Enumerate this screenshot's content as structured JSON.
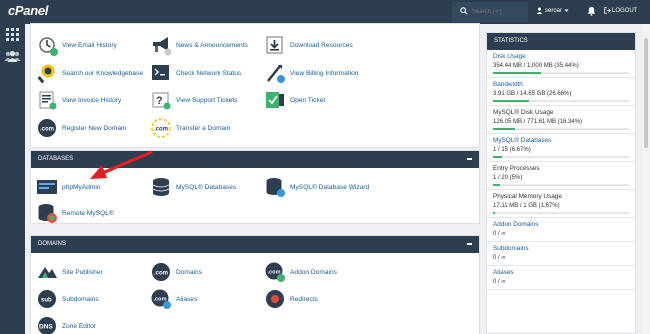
{
  "app": {
    "logo": "cPanel"
  },
  "header": {
    "search_placeholder": "Search ( / )",
    "user": "seroar",
    "logout": "LOGOUT"
  },
  "general": {
    "items": [
      {
        "label": "View Email History",
        "icon": "email-history-icon"
      },
      {
        "label": "News & Announcements",
        "icon": "megaphone-icon"
      },
      {
        "label": "Download Resources",
        "icon": "download-icon"
      },
      {
        "label": "Search our Knowledgebase",
        "icon": "knowledgebase-icon"
      },
      {
        "label": "Check Network Status",
        "icon": "network-status-icon"
      },
      {
        "label": "View Billing Information",
        "icon": "billing-icon"
      },
      {
        "label": "View Invoice History",
        "icon": "invoice-icon"
      },
      {
        "label": "View Support Tickets",
        "icon": "support-tickets-icon"
      },
      {
        "label": "Open Ticket",
        "icon": "open-ticket-icon"
      },
      {
        "label": "Register New Domain",
        "icon": "domain-register-icon"
      },
      {
        "label": "Transfer a Domain",
        "icon": "domain-transfer-icon"
      }
    ]
  },
  "databases": {
    "title": "DATABASES",
    "items": [
      {
        "label": "phpMyAdmin",
        "icon": "phpmyadmin-icon"
      },
      {
        "label": "MySQL® Databases",
        "icon": "mysql-databases-icon"
      },
      {
        "label": "MySQL® Database Wizard",
        "icon": "mysql-wizard-icon"
      },
      {
        "label": "Remote MySQL®",
        "icon": "remote-mysql-icon"
      }
    ]
  },
  "domains": {
    "title": "DOMAINS",
    "items": [
      {
        "label": "Site Publisher",
        "icon": "site-publisher-icon"
      },
      {
        "label": "Domains",
        "icon": "domains-icon"
      },
      {
        "label": "Addon Domains",
        "icon": "addon-domains-icon"
      },
      {
        "label": "Subdomains",
        "icon": "subdomains-icon"
      },
      {
        "label": "Aliases",
        "icon": "aliases-icon"
      },
      {
        "label": "Redirects",
        "icon": "redirects-icon"
      },
      {
        "label": "Zone Editor",
        "icon": "zone-editor-icon"
      }
    ]
  },
  "statistics": {
    "title": "STATISTICS",
    "items": [
      {
        "name": "Disk Usage",
        "value": "354.44 MB / 1,000 MB   (35.44%)",
        "percent": 35.44,
        "link": true
      },
      {
        "name": "Bandwidth",
        "value": "3.91 GB / 14.65 GB   (26.66%)",
        "percent": 26.66,
        "link": true
      },
      {
        "name": "MySQL® Disk Usage",
        "value": "126.05 MB / 771.61 MB   (16.34%)",
        "percent": 16.34,
        "link": false
      },
      {
        "name": "MySQL® Databases",
        "value": "1 / 15   (6.67%)",
        "percent": 6.67,
        "link": true
      },
      {
        "name": "Entry Processes",
        "value": "1 / 20   (5%)",
        "percent": 5,
        "link": false
      },
      {
        "name": "Physical Memory Usage",
        "value": "17.11 MB / 1 GB   (1.67%)",
        "percent": 1.67,
        "link": false
      },
      {
        "name": "Addon Domains",
        "value": "0 / ∞",
        "link": true
      },
      {
        "name": "Subdomains",
        "value": "0 / ∞",
        "link": true
      },
      {
        "name": "Aliases",
        "value": "0 / ∞",
        "link": true
      }
    ]
  },
  "colors": {
    "nav": "#2c3e50",
    "link": "#1a5e9e",
    "bar": "#3eb370",
    "arrow": "#e02020"
  }
}
